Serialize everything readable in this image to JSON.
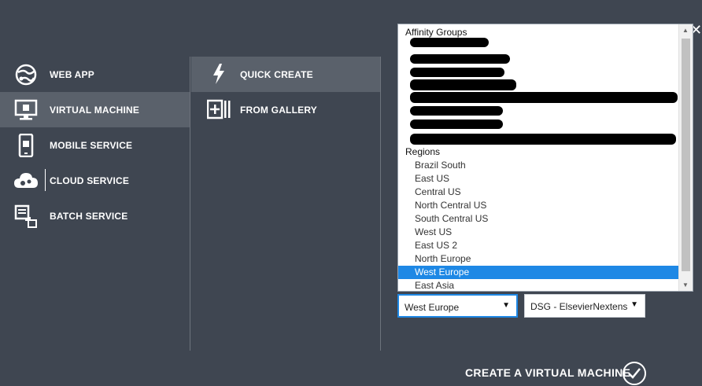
{
  "nav": {
    "items": [
      {
        "label": "WEB APP",
        "icon": "globe-icon"
      },
      {
        "label": "VIRTUAL MACHINE",
        "icon": "monitor-icon"
      },
      {
        "label": "MOBILE SERVICE",
        "icon": "phone-icon"
      },
      {
        "label": "CLOUD SERVICE",
        "icon": "cloud-gear-icon"
      },
      {
        "label": "BATCH SERVICE",
        "icon": "batch-icon"
      }
    ],
    "selected": "VIRTUAL MACHINE"
  },
  "create_options": {
    "items": [
      {
        "label": "QUICK CREATE",
        "icon": "lightning-icon"
      },
      {
        "label": "FROM GALLERY",
        "icon": "gallery-add-icon"
      }
    ],
    "selected": "QUICK CREATE"
  },
  "region_dropdown": {
    "affinity_header": "Affinity Groups",
    "regions_header": "Regions",
    "regions": [
      "Brazil South",
      "East US",
      "Central US",
      "North Central US",
      "South Central US",
      "West US",
      "East US 2",
      "North Europe",
      "West Europe",
      "East Asia"
    ],
    "highlighted": "West Europe"
  },
  "region_select": {
    "value": "West Europe"
  },
  "subscription_select": {
    "value": "DSG - ElsevierNextens"
  },
  "footer": {
    "create_label": "CREATE A VIRTUAL MACHINE"
  },
  "colors": {
    "background": "#3f4651",
    "selected_row": "#5a616b",
    "highlight": "#1e88e5"
  }
}
